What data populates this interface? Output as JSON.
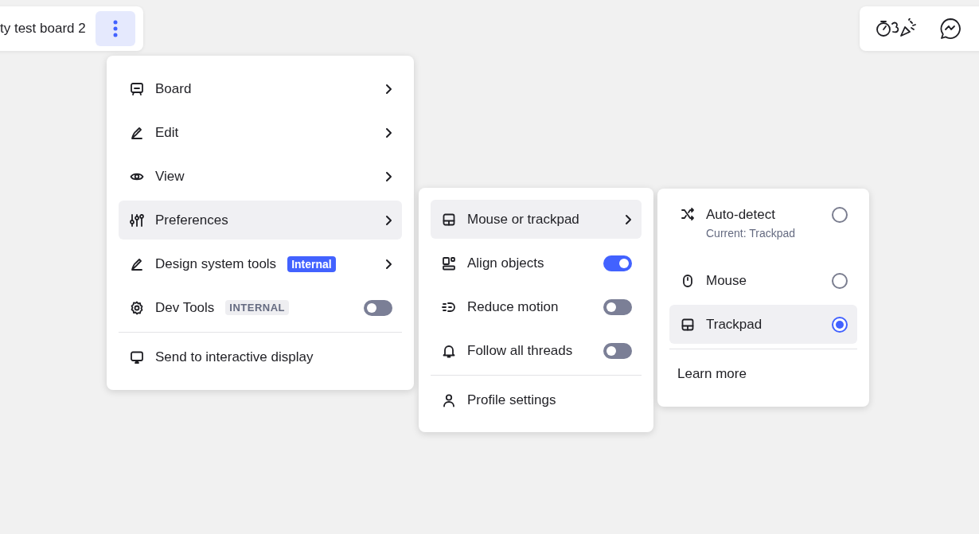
{
  "board": {
    "title": "ty test board 2"
  },
  "main_menu": {
    "items": [
      {
        "kind": "submenu",
        "label": "Board",
        "selected": false
      },
      {
        "kind": "submenu",
        "label": "Edit",
        "selected": false
      },
      {
        "kind": "submenu",
        "label": "View",
        "selected": false
      },
      {
        "kind": "submenu",
        "label": "Preferences",
        "selected": true
      },
      {
        "kind": "submenu",
        "label": "Design system tools",
        "selected": false,
        "badge": {
          "text": "Internal",
          "kind": "strong"
        }
      },
      {
        "kind": "toggle",
        "label": "Dev Tools",
        "on": false,
        "badge": {
          "text": "INTERNAL",
          "kind": "muted"
        }
      },
      {
        "kind": "divider"
      },
      {
        "kind": "action",
        "label": "Send to interactive display"
      }
    ]
  },
  "preferences_menu": {
    "items": [
      {
        "kind": "submenu",
        "label": "Mouse or trackpad",
        "selected": true
      },
      {
        "kind": "toggle",
        "label": "Align objects",
        "on": true
      },
      {
        "kind": "toggle",
        "label": "Reduce motion",
        "on": false
      },
      {
        "kind": "toggle",
        "label": "Follow all threads",
        "on": false
      },
      {
        "kind": "divider"
      },
      {
        "kind": "action",
        "label": "Profile settings"
      }
    ]
  },
  "input_menu": {
    "items": [
      {
        "kind": "radio",
        "label": "Auto-detect",
        "subtitle": "Current: Trackpad",
        "selected": false
      },
      {
        "kind": "radio",
        "label": "Mouse",
        "selected": false
      },
      {
        "kind": "radio",
        "label": "Trackpad",
        "selected": true
      },
      {
        "kind": "divider"
      },
      {
        "kind": "link",
        "label": "Learn more"
      }
    ]
  }
}
